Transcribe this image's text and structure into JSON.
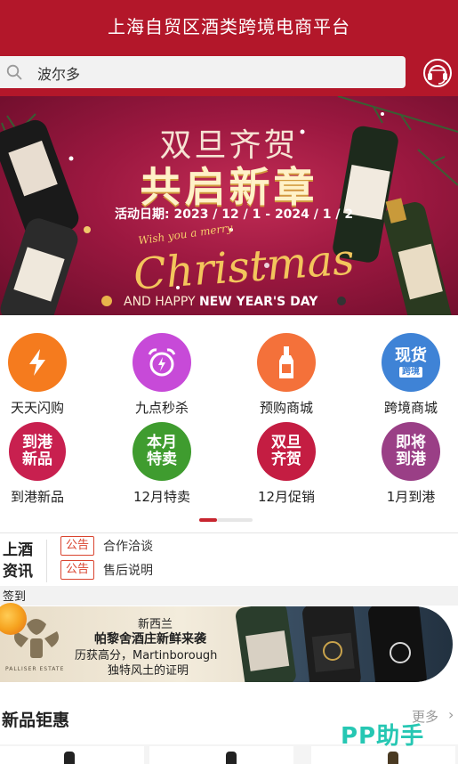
{
  "header": {
    "title": "上海自贸区酒类跨境电商平台",
    "search_value": "波尔多",
    "icons": {
      "search": "search-icon",
      "service": "headset-icon"
    }
  },
  "banner": {
    "title1": "双旦齐贺",
    "title2": "共启新章",
    "date": "活动日期: 2023 / 12 / 1 - 2024 / 1 / 2",
    "wish": "Wish you a merry",
    "script": "Christmas",
    "new_year_prefix": "AND HAPPY ",
    "new_year": "NEW YEAR'S DAY"
  },
  "categories": [
    {
      "label": "天天闪购",
      "circle_text": "",
      "icon": "lightning-icon",
      "color": "#f57b1e"
    },
    {
      "label": "九点秒杀",
      "circle_text": "",
      "icon": "alarm-clock-icon",
      "color": "#c74ad8"
    },
    {
      "label": "预购商城",
      "circle_text": "",
      "icon": "wine-bottle-icon",
      "color": "#f4713a"
    },
    {
      "label": "跨境商城",
      "circle_text": "现货",
      "sub_text": "跨境",
      "icon": "spot-goods-icon",
      "color": "#3f83d6"
    },
    {
      "label": "到港新品",
      "circle_text": "到港新品",
      "icon": "",
      "color": "#c8204f"
    },
    {
      "label": "12月特卖",
      "circle_text": "本月特卖",
      "icon": "",
      "color": "#3f9c2f"
    },
    {
      "label": "12月促销",
      "circle_text": "双旦齐贺",
      "icon": "",
      "color": "#c41d42"
    },
    {
      "label": "1月到港",
      "circle_text": "即将到港",
      "icon": "",
      "color": "#9a3f86"
    }
  ],
  "pager": {
    "current": 1,
    "total": 3
  },
  "news": {
    "brand_line1": "上酒",
    "brand_line2": "资讯",
    "items": [
      {
        "tag": "公告",
        "text": "合作洽谈"
      },
      {
        "tag": "公告",
        "text": "售后说明"
      }
    ]
  },
  "signin": {
    "label": "签到",
    "icon": "sign-in-badge-icon"
  },
  "promo": {
    "line1": "新西兰",
    "line2": "帕黎舍酒庄新鲜来袭",
    "line3": "历获高分，Martinborough",
    "line4": "独特风土的证明",
    "estate": "PALLISER ESTATE"
  },
  "new_products": {
    "title": "新品钜惠",
    "more": "更多",
    "more_icon": "chevron-right-icon"
  },
  "watermark": "PP助手",
  "colors": {
    "brand": "#b3172a",
    "tag": "#d9442f",
    "watermark": "#26c7b3"
  }
}
